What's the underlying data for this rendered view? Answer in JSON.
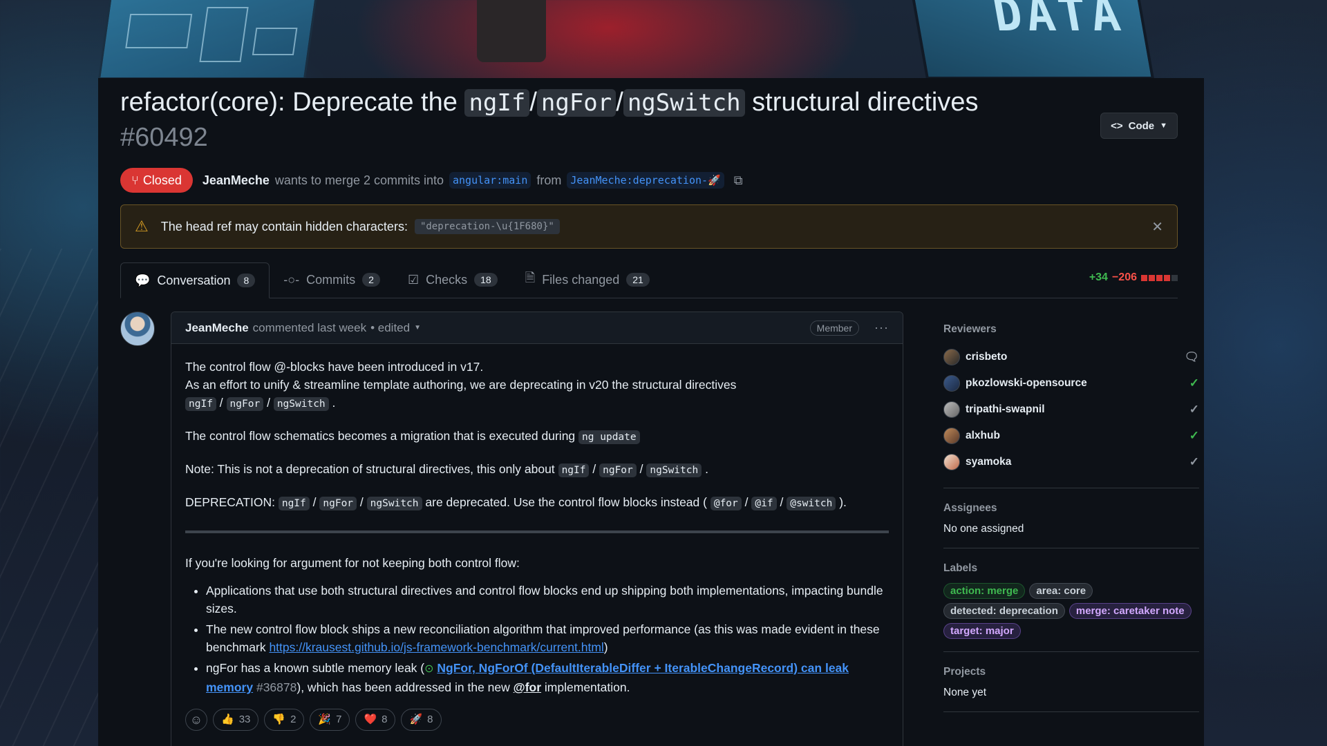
{
  "pr": {
    "title_prefix": "refactor(core): Deprecate the ",
    "title_code1": "ngIf",
    "title_sep1": "/",
    "title_code2": "ngFor",
    "title_sep2": "/",
    "title_code3": "ngSwitch",
    "title_suffix": " structural directives",
    "number": "#60492",
    "code_button": "Code",
    "state": "Closed",
    "author": "JeanMeche",
    "merge_text": "wants to merge 2 commits into",
    "base_branch": "angular:main",
    "from_text": "from",
    "head_branch": "JeanMeche:deprecation-🚀"
  },
  "warning": {
    "text": "The head ref may contain hidden characters:",
    "code": "\"deprecation-\\u{1F680}\""
  },
  "tabs": [
    {
      "label": "Conversation",
      "count": "8"
    },
    {
      "label": "Commits",
      "count": "2"
    },
    {
      "label": "Checks",
      "count": "18"
    },
    {
      "label": "Files changed",
      "count": "21"
    }
  ],
  "diffstat": {
    "additions": "+34",
    "deletions": "−206"
  },
  "comment": {
    "author": "JeanMeche",
    "action": "commented last week",
    "edited": "• edited",
    "badge": "Member",
    "p1_line1": "The control flow @-blocks have been introduced in v17.",
    "p1_line2": "As an effort to unify & streamline template authoring, we are deprecating in v20 the structural directives",
    "code_ngif": "ngIf",
    "code_ngfor": "ngFor",
    "code_ngswitch": "ngSwitch",
    "slash": "/",
    "period": ".",
    "p2": "The control flow schematics becomes a migration that is executed during",
    "code_ngupdate": "ng update",
    "p3": "Note: This is not a deprecation of structural directives, this only about",
    "p4_prefix": "DEPRECATION:",
    "p4_mid": "are deprecated. Use the control flow blocks instead (",
    "code_for": "@for",
    "code_if": "@if",
    "code_switch": "@switch",
    "p4_end": ").",
    "p5": "If you're looking for argument for not keeping both control flow:",
    "li1": "Applications that use both structural directives and control flow blocks end up shipping both implementations, impacting bundle sizes.",
    "li2_text": "The new control flow block ships a new reconciliation algorithm that improved performance (as this was made evident in these benchmark",
    "li2_link": "https://krausest.github.io/js-framework-benchmark/current.html",
    "li2_end": ")",
    "li3_text": "ngFor has a known subtle memory leak (",
    "li3_link": "NgFor, NgForOf (DefaultIterableDiffer + IterableChangeRecord) can leak memory",
    "li3_num": "#36878",
    "li3_mid": "), which has been addressed in the new",
    "li3_mention": "@for",
    "li3_end": "implementation.",
    "reactions": [
      {
        "emoji": "👍",
        "count": "33"
      },
      {
        "emoji": "👎",
        "count": "2"
      },
      {
        "emoji": "🎉",
        "count": "7"
      },
      {
        "emoji": "❤️",
        "count": "8"
      },
      {
        "emoji": "🚀",
        "count": "8"
      }
    ]
  },
  "sidebar": {
    "reviewers_title": "Reviewers",
    "reviewers": [
      {
        "name": "crisbeto",
        "status": "commented"
      },
      {
        "name": "pkozlowski-opensource",
        "status": "approved"
      },
      {
        "name": "tripathi-swapnil",
        "status": "approved-grey"
      },
      {
        "name": "alxhub",
        "status": "approved"
      },
      {
        "name": "syamoka",
        "status": "approved-grey"
      }
    ],
    "assignees_title": "Assignees",
    "assignees_text": "No one assigned",
    "labels_title": "Labels",
    "labels": [
      {
        "text": "action: merge",
        "color": "#3fb950"
      },
      {
        "text": "area: core",
        "color": "#c9d1d9"
      },
      {
        "text": "detected: deprecation",
        "color": "#c9d1d9"
      },
      {
        "text": "merge: caretaker note",
        "color": "#d2a8ff"
      },
      {
        "text": "target: major",
        "color": "#d2a8ff"
      }
    ],
    "projects_title": "Projects",
    "projects_text": "None yet"
  }
}
